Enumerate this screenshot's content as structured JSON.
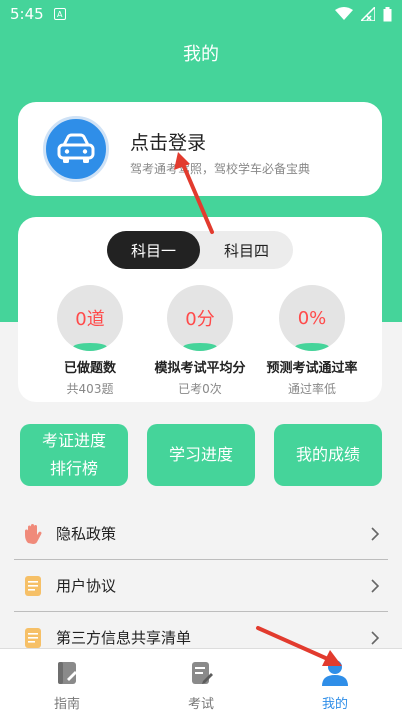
{
  "status_bar": {
    "time": "5:45",
    "notification_letter": "A"
  },
  "header": {
    "title": "我的"
  },
  "login_card": {
    "title": "点击登录",
    "subtitle": "驾考通考驾照，驾校学车必备宝典",
    "avatar_icon": "car-icon"
  },
  "stats": {
    "tabs": [
      {
        "label": "科目一",
        "active": true
      },
      {
        "label": "科目四",
        "active": false
      }
    ],
    "items": [
      {
        "value": "0道",
        "label": "已做题数",
        "sub": "共403题"
      },
      {
        "value": "0分",
        "label": "模拟考试平均分",
        "sub": "已考0次"
      },
      {
        "value": "0%",
        "label": "预测考试通过率",
        "sub": "通过率低"
      }
    ]
  },
  "actions": [
    {
      "line1": "考证进度",
      "line2": "排行榜"
    },
    {
      "line1": "学习进度",
      "line2": ""
    },
    {
      "line1": "我的成绩",
      "line2": ""
    }
  ],
  "menu": [
    {
      "label": "隐私政策",
      "icon": "hand-icon"
    },
    {
      "label": "用户协议",
      "icon": "document-icon"
    },
    {
      "label": "第三方信息共享清单",
      "icon": "document-icon"
    }
  ],
  "tab_bar": [
    {
      "label": "指南",
      "icon": "book-icon",
      "active": false
    },
    {
      "label": "考试",
      "icon": "exam-icon",
      "active": false
    },
    {
      "label": "我的",
      "icon": "user-icon",
      "active": true
    }
  ],
  "colors": {
    "accent": "#45d49a",
    "primary_blue": "#2f8ee8",
    "value_red": "#ff4a4a",
    "arrow_red": "#e23b2e"
  }
}
